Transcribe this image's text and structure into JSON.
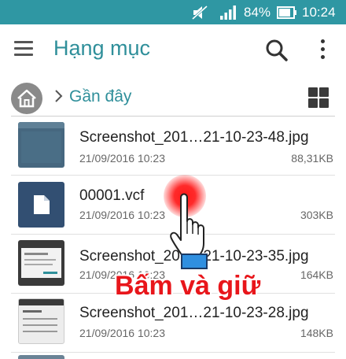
{
  "status_bar": {
    "battery_percent": "84%",
    "time": "10:24",
    "icons": [
      "mute-icon",
      "signal-icon",
      "battery-icon"
    ]
  },
  "app_bar": {
    "title": "Hạng mục",
    "icons": [
      "menu-icon",
      "search-icon",
      "more-vert-icon"
    ]
  },
  "breadcrumb": {
    "label": "Gần đây",
    "icons": [
      "home-icon",
      "chevron-right-icon",
      "grid-view-icon"
    ]
  },
  "files": [
    {
      "name": "Screenshot_201…21-10-23-48.jpg",
      "date": "21/09/2016 10:23",
      "size": "88,31KB",
      "thumb": "screenshot-thumb-icon"
    },
    {
      "name": "00001.vcf",
      "date": "21/09/2016 10:23",
      "size": "303KB",
      "thumb": "document-icon"
    },
    {
      "name": "Screenshot_201…21-10-23-35.jpg",
      "date": "21/09/2016 10:23",
      "size": "164KB",
      "thumb": "screenshot-thumb-icon"
    },
    {
      "name": "Screenshot_201…21-10-23-28.jpg",
      "date": "21/09/2016 10:23",
      "size": "148KB",
      "thumb": "screenshot-thumb-icon"
    }
  ],
  "overlay": {
    "caption": "Bấm và giữ",
    "icons": [
      "touch-glow-icon",
      "pointing-hand-icon"
    ]
  },
  "colors": {
    "status_bar": "#2f97a3",
    "accent": "#2f8f9a",
    "doc_thumb": "#324f72",
    "caption": "#e8161b"
  }
}
